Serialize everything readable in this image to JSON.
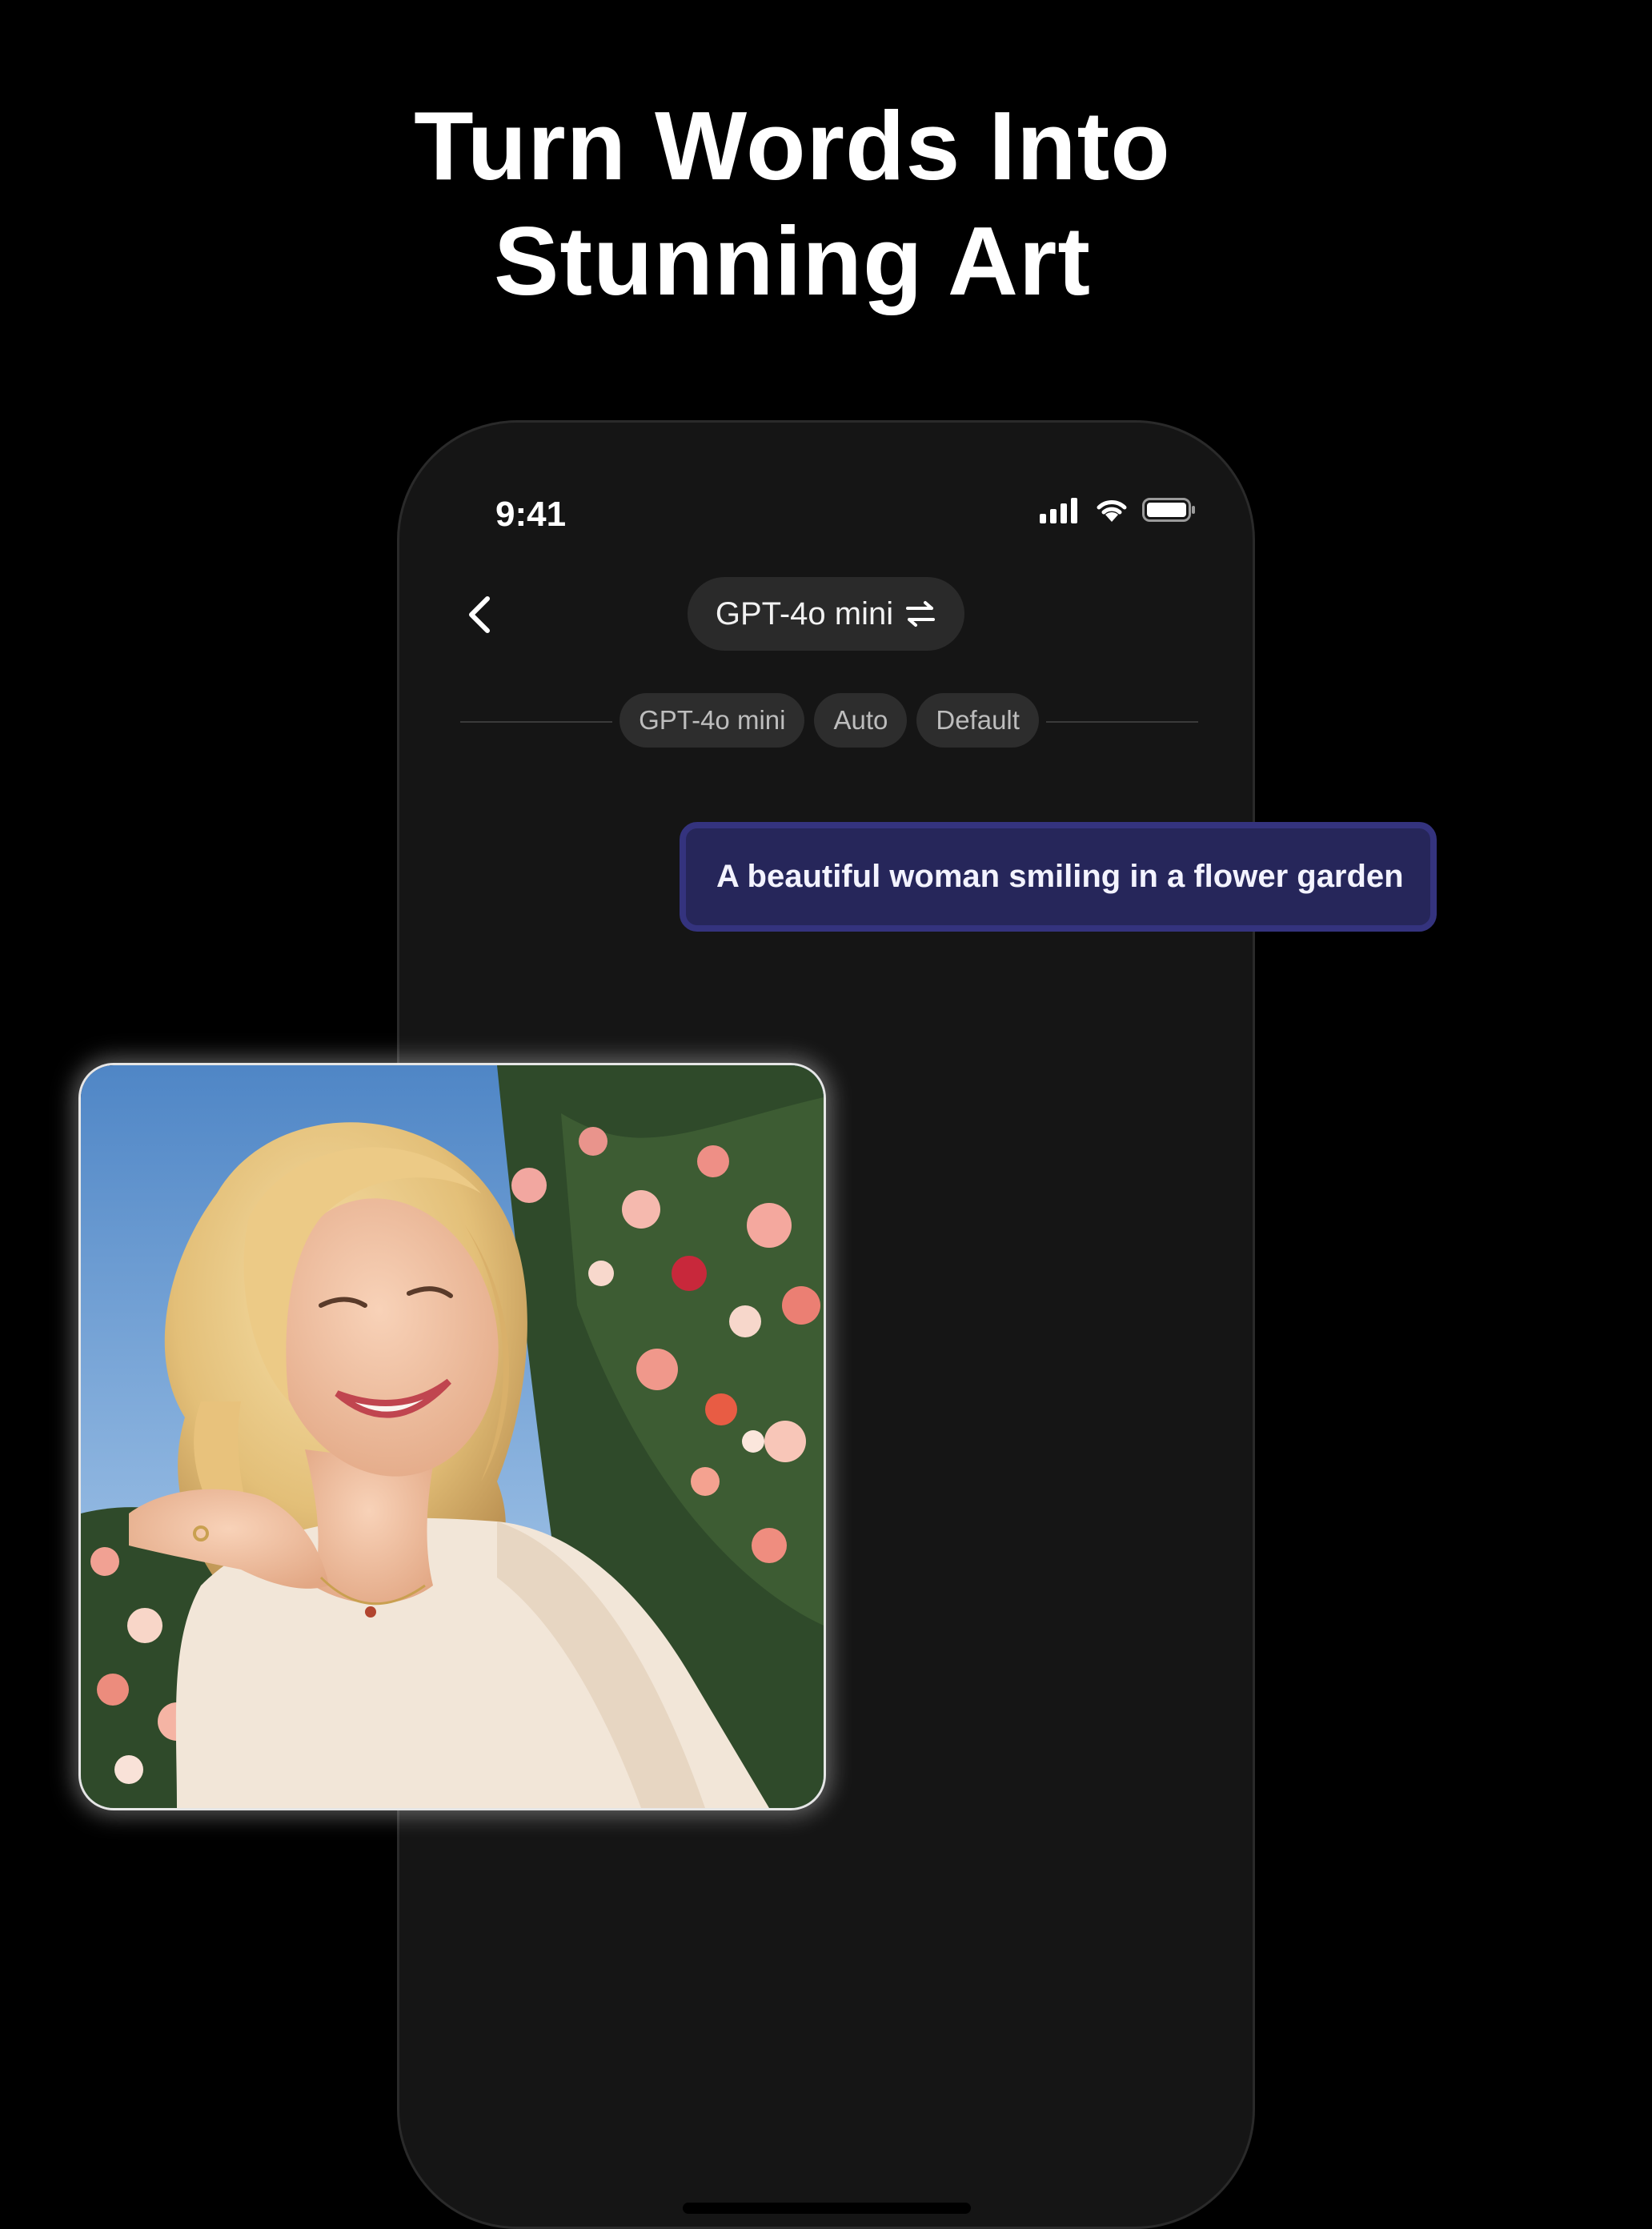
{
  "headline": {
    "line1": "Turn Words Into",
    "line2": "Stunning Art"
  },
  "status_bar": {
    "time": "9:41",
    "icons": [
      "signal-icon",
      "wifi-icon",
      "battery-icon"
    ]
  },
  "nav": {
    "back_icon": "chevron-left-icon",
    "model_selector": {
      "label": "GPT-4o mini",
      "icon": "swap-arrows-icon"
    }
  },
  "settings_tags": [
    "GPT-4o mini",
    "Auto",
    "Default"
  ],
  "prompt": {
    "text": "A beautiful woman smiling in a flower garden"
  },
  "generated_image": {
    "subject": "generated-portrait-image"
  },
  "colors": {
    "background": "#000000",
    "phone": "#151515",
    "pill": "#2a2a2a",
    "prompt_bubble": "#26265a",
    "prompt_border": "#34337e"
  }
}
